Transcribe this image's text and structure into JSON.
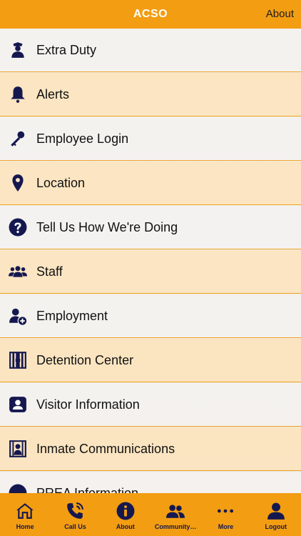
{
  "header": {
    "title": "ACSO",
    "about_label": "About"
  },
  "menu": {
    "items": [
      {
        "label": "Extra Duty",
        "icon": "officer-icon"
      },
      {
        "label": "Alerts",
        "icon": "bell-icon"
      },
      {
        "label": "Employee Login",
        "icon": "key-icon"
      },
      {
        "label": "Location",
        "icon": "map-pin-icon"
      },
      {
        "label": "Tell Us How We're Doing",
        "icon": "question-icon"
      },
      {
        "label": "Staff",
        "icon": "group-icon"
      },
      {
        "label": "Employment",
        "icon": "add-user-icon"
      },
      {
        "label": "Detention Center",
        "icon": "jail-cell-icon"
      },
      {
        "label": "Visitor Information",
        "icon": "visitor-badge-icon"
      },
      {
        "label": "Inmate Communications",
        "icon": "inmate-icon"
      },
      {
        "label": "PREA Information",
        "icon": "info-icon"
      }
    ]
  },
  "tabbar": {
    "tabs": [
      {
        "label": "Home",
        "icon": "home-icon"
      },
      {
        "label": "Call Us",
        "icon": "phone-icon"
      },
      {
        "label": "About",
        "icon": "info-icon"
      },
      {
        "label": "Community…",
        "icon": "community-icon"
      },
      {
        "label": "More",
        "icon": "more-dots-icon"
      },
      {
        "label": "Logout",
        "icon": "user-icon"
      }
    ]
  },
  "colors": {
    "accent": "#f29d12",
    "icon": "#15184f"
  }
}
